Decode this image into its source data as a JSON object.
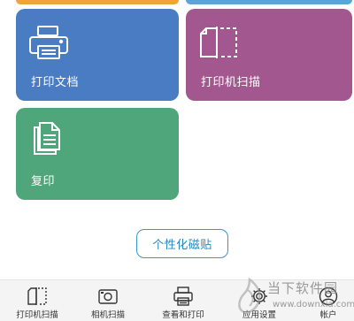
{
  "colors": {
    "print_tile": "#4a7cc4",
    "scan_tile": "#a3578f",
    "copy_tile": "#4ea67a",
    "accent": "#2288bb",
    "top_orange": "#f0a33a",
    "top_blue": "#5aa4d8"
  },
  "tiles": [
    {
      "label": "打印文档",
      "icon": "printer-icon"
    },
    {
      "label": "打印机扫描",
      "icon": "scanner-document-icon"
    },
    {
      "label": "复印",
      "icon": "copy-document-icon"
    }
  ],
  "personalize_button": "个性化磁贴",
  "nav": [
    {
      "label": "打印机扫描",
      "icon": "scanner-icon"
    },
    {
      "label": "相机扫描",
      "icon": "camera-icon"
    },
    {
      "label": "查看和打印",
      "icon": "printer-icon"
    },
    {
      "label": "应用设置",
      "icon": "gear-icon"
    },
    {
      "label": "帐户",
      "icon": "account-icon"
    }
  ],
  "watermark": {
    "title": "当下软件园",
    "url": "www.downxia.com"
  }
}
